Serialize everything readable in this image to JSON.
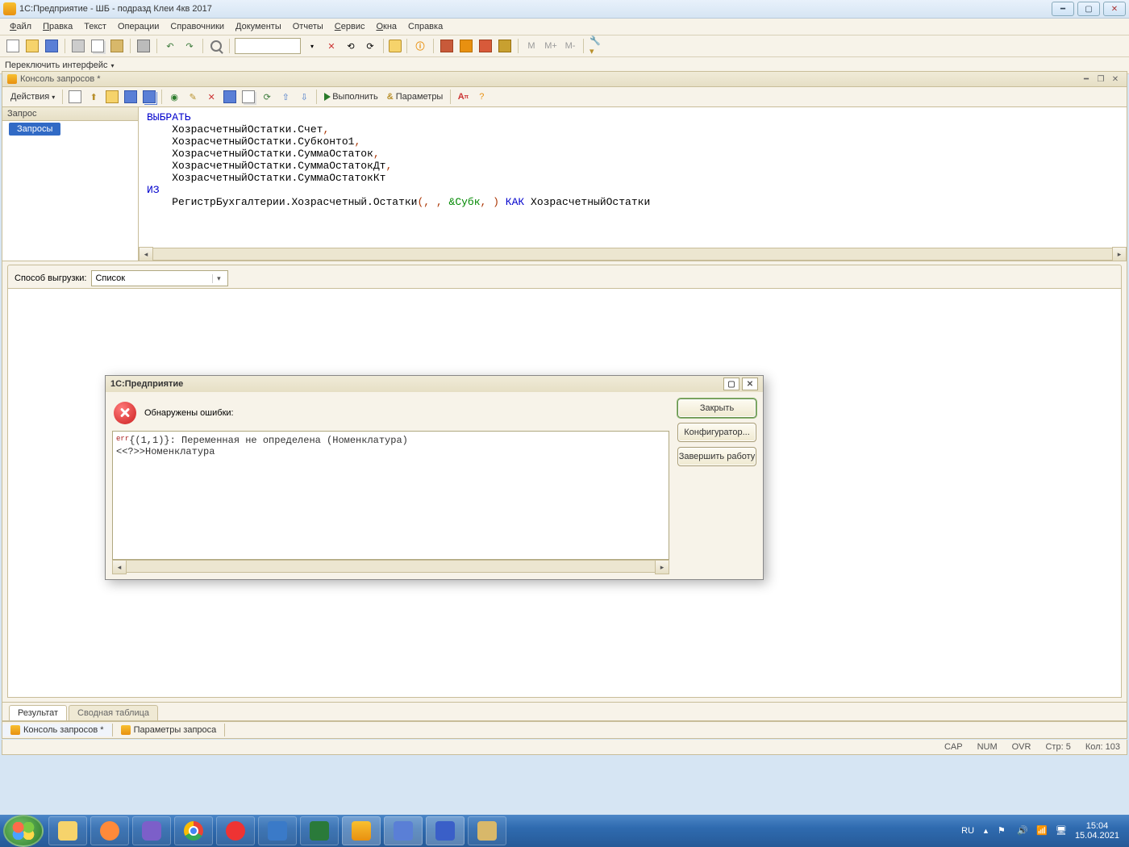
{
  "window": {
    "title": "1С:Предприятие - ШБ - подразд Клеи 4кв 2017"
  },
  "menu": {
    "file": "Файл",
    "edit": "Правка",
    "text": "Текст",
    "operations": "Операции",
    "refs": "Справочники",
    "docs": "Документы",
    "reports": "Отчеты",
    "service": "Сервис",
    "windows": "Окна",
    "help": "Справка"
  },
  "iface": {
    "switch": "Переключить интерфейс"
  },
  "mdi": {
    "title": "Консоль запросов *"
  },
  "qtoolbar": {
    "actions": "Действия",
    "run": "Выполнить",
    "params": "Параметры"
  },
  "tree": {
    "header": "Запрос",
    "item": "Запросы"
  },
  "query": {
    "kw_select": "ВЫБРАТЬ",
    "l1": "ХозрасчетныйОстатки.Счет",
    "l2": "ХозрасчетныйОстатки.Субконто1",
    "l3": "ХозрасчетныйОстатки.СуммаОстаток",
    "l4": "ХозрасчетныйОстатки.СуммаОстатокДт",
    "l5": "ХозрасчетныйОстатки.СуммаОстатокКт",
    "kw_from": "ИЗ",
    "l6a": "РегистрБухгалтерии.Хозрасчетный.Остатки",
    "l6_param": "&Субк",
    "kw_as": "КАК",
    "l6b": "ХозрасчетныйОстатки"
  },
  "export": {
    "label": "Способ выгрузки:",
    "value": "Список"
  },
  "tabs": {
    "result": "Результат",
    "pivot": "Сводная таблица"
  },
  "doctabs": {
    "t1": "Консоль запросов *",
    "t2": "Параметры запроса"
  },
  "status": {
    "cap": "CAP",
    "num": "NUM",
    "ovr": "OVR",
    "row_lbl": "Стр:",
    "row": "5",
    "col_lbl": "Кол:",
    "col": "103"
  },
  "dialog": {
    "title": "1С:Предприятие",
    "header": "Обнаружены ошибки:",
    "err_tag": "err",
    "line1": "{(1,1)}: Переменная не определена (Номенклатура)",
    "line2": "<<?>>Номенклатура",
    "btn_close": "Закрыть",
    "btn_config": "Конфигуратор...",
    "btn_exit": "Завершить работу"
  },
  "tray": {
    "lang": "RU",
    "time": "15:04",
    "date": "15.04.2021"
  }
}
